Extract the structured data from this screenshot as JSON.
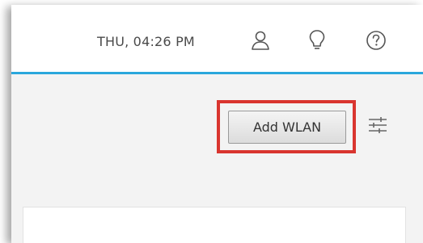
{
  "header": {
    "datetime": "THU, 04:26 PM",
    "accent_color": "#2aa7dc"
  },
  "icons": {
    "user": "user-icon",
    "bulb": "lightbulb-icon",
    "help": "help-icon",
    "filter": "sliders-icon"
  },
  "toolbar": {
    "add_wlan_label": "Add WLAN",
    "highlight_color": "#d9352f"
  }
}
